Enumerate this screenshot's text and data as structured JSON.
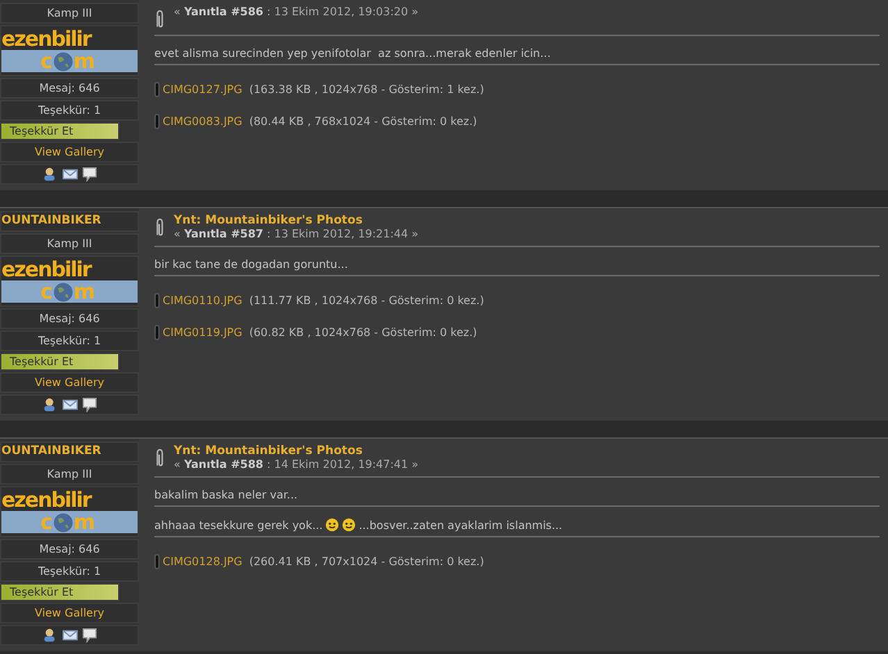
{
  "posts": [
    {
      "rank": "Kamp III",
      "logo": {
        "top": "ezenbilir",
        "left": "c",
        "right": "m"
      },
      "stats": [
        "Mesaj: 646",
        "Teşekkür: 1"
      ],
      "thank_button": "Teşekkür Et",
      "gallery_link": "View Gallery",
      "header": "« **Yanıtla #586** : 13 Ekim 2012, 19:03:20 »",
      "paragraphs": [
        [
          {
            "kind": "text",
            "text": "evet alisma surecinden yep yenifotolar  az sonra...merak edenler icin..."
          }
        ]
      ],
      "attachments": [
        {
          "name": "CIMG0127.JPG",
          "info": "(163.38 KB , 1024x768 - Gösterim: 1 kez.)"
        },
        {
          "name": "CIMG0083.JPG",
          "info": "(80.44 KB , 768x1024 - Gösterim: 0 kez.)"
        }
      ]
    },
    {
      "author": "OUNTAINBIKER",
      "rank": "Kamp III",
      "logo": {
        "top": "ezenbilir",
        "left": "c",
        "right": "m"
      },
      "stats": [
        "Mesaj: 646",
        "Teşekkür: 1"
      ],
      "thank_button": "Teşekkür Et",
      "gallery_link": "View Gallery",
      "title": "Ynt: Mountainbiker's Photos",
      "header": "« **Yanıtla #587** : 13 Ekim 2012, 19:21:44 »",
      "paragraphs": [
        [
          {
            "kind": "text",
            "text": "bir kac tane de dogadan goruntu..."
          }
        ]
      ],
      "attachments": [
        {
          "name": "CIMG0110.JPG",
          "info": "(111.77 KB , 1024x768 - Gösterim: 0 kez.)"
        },
        {
          "name": "CIMG0119.JPG",
          "info": "(60.82 KB , 1024x768 - Gösterim: 0 kez.)"
        }
      ]
    },
    {
      "author": "OUNTAINBIKER",
      "rank": "Kamp III",
      "logo": {
        "top": "ezenbilir",
        "left": "c",
        "right": "m"
      },
      "stats": [
        "Mesaj: 646",
        "Teşekkür: 1"
      ],
      "thank_button": "Teşekkür Et",
      "gallery_link": "View Gallery",
      "title": "Ynt: Mountainbiker's Photos",
      "header": "« **Yanıtla #588** : 14 Ekim 2012, 19:47:41 »",
      "paragraphs": [
        [
          {
            "kind": "text",
            "text": "bakalim baska neler var..."
          }
        ],
        [
          {
            "kind": "text",
            "text": "ahhaaa tesekkure gerek yok..."
          },
          {
            "kind": "smiley"
          },
          {
            "kind": "smiley"
          },
          {
            "kind": "text",
            "text": "...bosver..zaten ayaklarim islanmis..."
          }
        ]
      ],
      "attachments": [
        {
          "name": "CIMG0128.JPG",
          "info": "(260.41 KB , 707x1024 - Gösterim: 0 kez.)"
        }
      ]
    }
  ]
}
